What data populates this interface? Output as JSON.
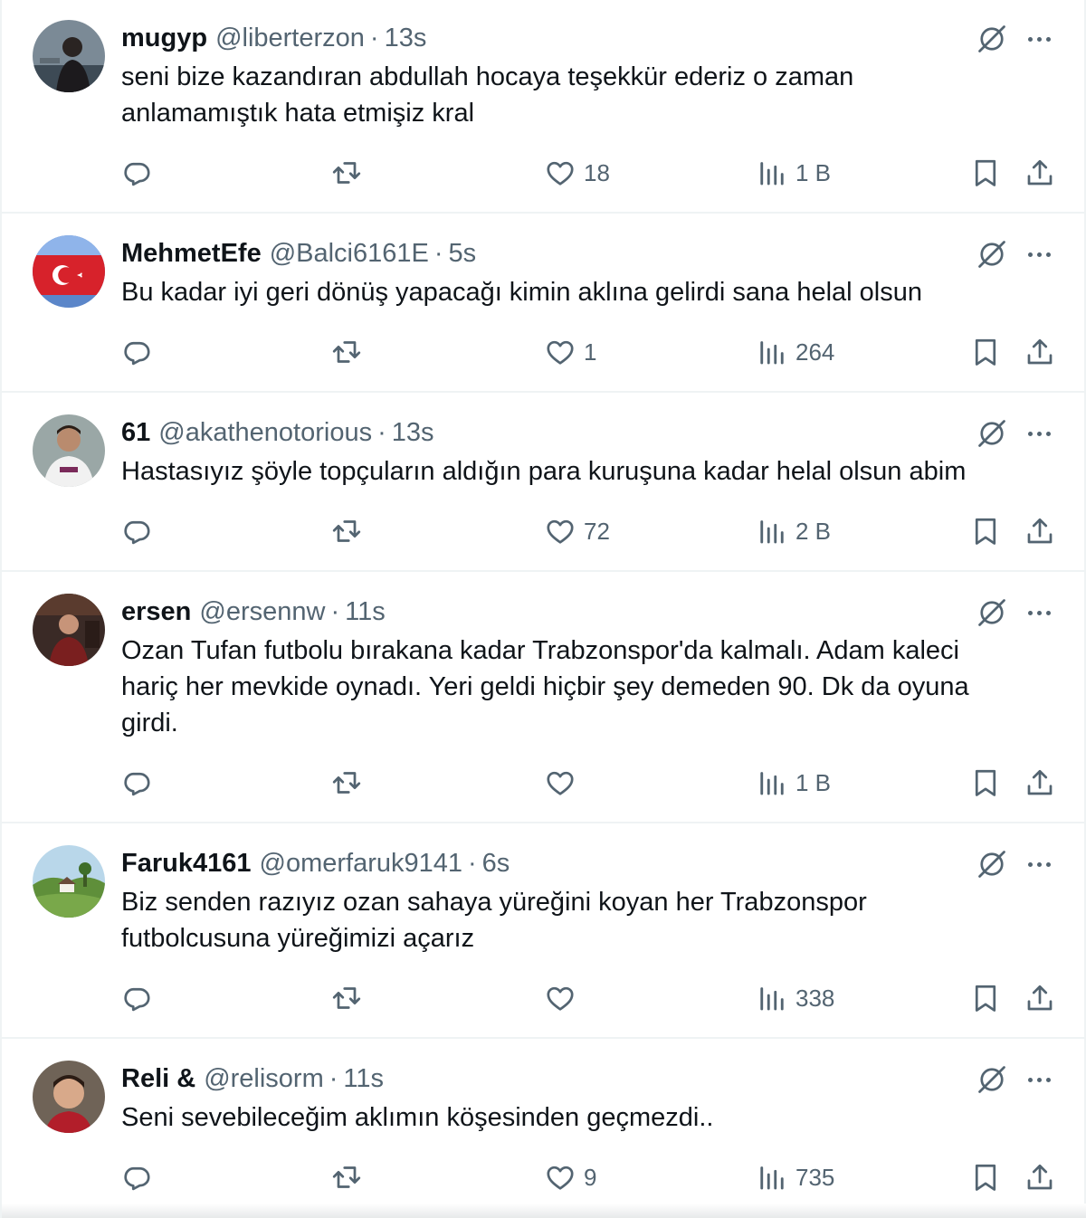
{
  "tweets": [
    {
      "name": "mugyp",
      "handle": "@liberterzon",
      "separator": "·",
      "time": "13s",
      "lines": [
        "seni bize kazandıran abdullah hocaya teşekkür ederiz o zaman",
        "anlamamıştık hata etmişiz kral"
      ],
      "likes": "18",
      "views": "1 B"
    },
    {
      "name": "MehmetEfe",
      "handle": "@Balci6161E",
      "separator": "·",
      "time": "5s",
      "lines": [
        "Bu kadar iyi geri dönüş yapacağı kimin aklına gelirdi sana helal olsun"
      ],
      "likes": "1",
      "views": "264"
    },
    {
      "name": "61",
      "handle": "@akathenotorious",
      "separator": "·",
      "time": "13s",
      "lines": [
        "Hastasıyız şöyle topçuların aldığın para kuruşuna kadar helal olsun abim"
      ],
      "likes": "72",
      "views": "2 B"
    },
    {
      "name": "ersen",
      "handle": "@ersennw",
      "separator": "·",
      "time": "11s",
      "lines": [
        "Ozan Tufan futbolu bırakana kadar Trabzonspor'da kalmalı. Adam kaleci",
        "hariç her mevkide oynadı. Yeri geldi hiçbir şey demeden 90. Dk da oyuna",
        "girdi."
      ],
      "likes": "",
      "views": "1 B"
    },
    {
      "name": "Faruk4161",
      "handle": "@omerfaruk9141",
      "separator": "·",
      "time": "6s",
      "lines": [
        "Biz senden razıyız ozan sahaya yüreğini koyan her Trabzonspor",
        "futbolcusuna yüreğimizi açarız"
      ],
      "likes": "",
      "views": "338"
    },
    {
      "name": "Reli &",
      "handle": "@relisorm",
      "separator": "·",
      "time": "11s",
      "lines": [
        "Seni sevebileceğim aklımın köşesinden geçmezdi.."
      ],
      "likes": "9",
      "views": "735"
    }
  ],
  "icons": {
    "reply": "reply-icon",
    "retweet": "retweet-icon",
    "like": "heart-icon",
    "views": "views-icon",
    "bookmark": "bookmark-icon",
    "share": "share-icon",
    "grok": "grok-icon",
    "more": "more-icon"
  },
  "colors": {
    "text_primary": "#0f1419",
    "text_secondary": "#536471",
    "divider": "#eff3f4"
  }
}
